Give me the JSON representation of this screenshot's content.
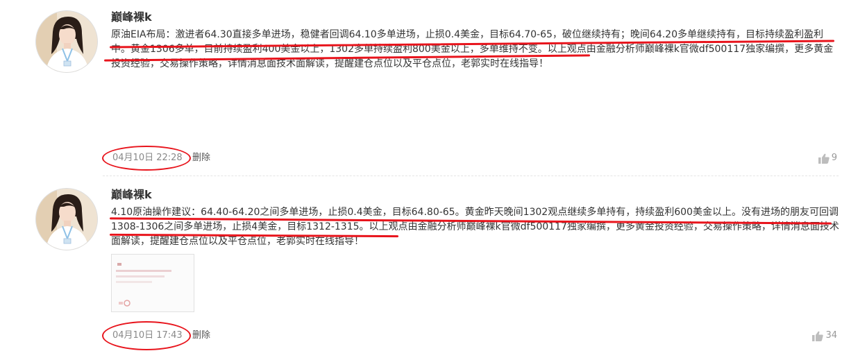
{
  "posts": [
    {
      "author": "巅峰裸k",
      "content": "原油EIA布局：激进者64.30直接多单进场，稳健者回调64.10多单进场，止损0.4美金，目标64.70-65，破位继续持有；晚间64.20多单继续持有，目标持续盈利盈利中。黄金1306多单，目前持续盈利400美金以上，1302多单持续盈利800美金以上，多单维持不变。以上观点由金融分析师巅峰裸k官微df500117独家编撰，更多黄金投资经验，交易操作策略，详情消息面技术面解读，提醒建仓点位以及平仓点位，老郭实时在线指导！",
      "time": "04月10日 22:28",
      "delete_label": "删除",
      "likes": "9"
    },
    {
      "author": "巅峰裸k",
      "content": "4.10原油操作建议：64.40-64.20之间多单进场，止损0.4美金，目标64.80-65。黄金昨天晚间1302观点继续多单持有，持续盈利600美金以上。没有进场的朋友可回调1308-1306之间多单进场，止损4美金，目标1312-1315。以上观点由金融分析师巅峰裸k官微df500117独家编撰，更多黄金投资经验，交易操作策略，详情消息面技术面解读，提醒建仓点位以及平仓点位，老郭实时在线指导！",
      "time": "04月10日 17:43",
      "delete_label": "删除",
      "likes": "34"
    }
  ],
  "colors": {
    "annotation_red": "#e8141c",
    "text": "#333333",
    "meta": "#888888"
  },
  "icons": {
    "like": "thumbs-up-icon"
  }
}
